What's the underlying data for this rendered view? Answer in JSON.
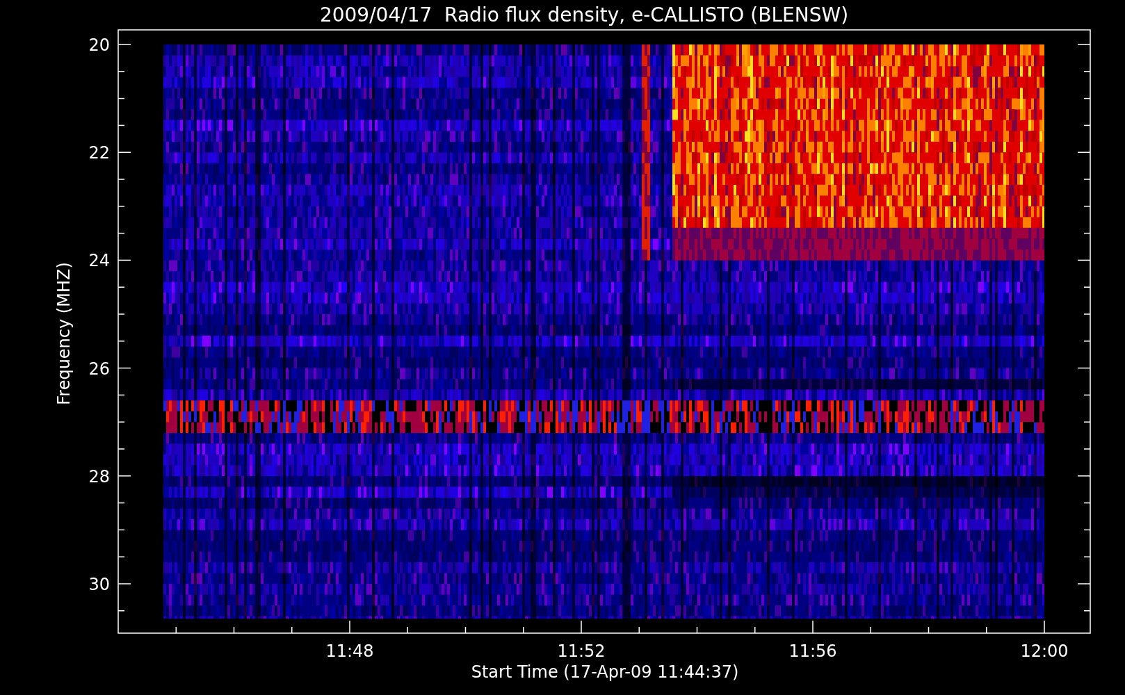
{
  "chart": {
    "title": "2009/04/17  Radio flux density, e-CALLISTO (BLENSW)",
    "ylabel": "Frequency (MHZ)",
    "xlabel": "Start Time (17-Apr-09 11:44:37)",
    "y_tick_labels": [
      "20",
      "22",
      "24",
      "26",
      "28",
      "30"
    ],
    "x_tick_labels": [
      "11:48",
      "11:52",
      "11:56",
      "12:00"
    ]
  }
}
